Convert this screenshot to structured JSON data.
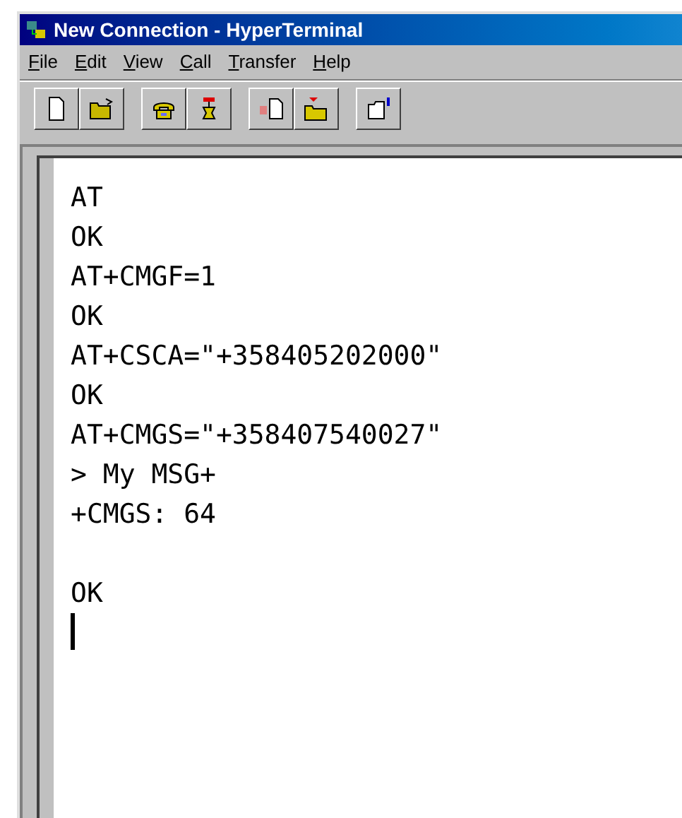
{
  "window": {
    "title": "New Connection - HyperTerminal"
  },
  "menu": [
    "File",
    "Edit",
    "View",
    "Call",
    "Transfer",
    "Help"
  ],
  "toolbar": [
    {
      "kind": "new"
    },
    {
      "kind": "open"
    },
    {
      "kind": "gap"
    },
    {
      "kind": "call"
    },
    {
      "kind": "hangup"
    },
    {
      "kind": "gap"
    },
    {
      "kind": "send"
    },
    {
      "kind": "receive"
    },
    {
      "kind": "gap"
    },
    {
      "kind": "properties"
    }
  ],
  "terminal": {
    "cursor": true,
    "lines": [
      {
        "kind": "text",
        "text": "AT"
      },
      {
        "kind": "text",
        "text": "OK"
      },
      {
        "kind": "text",
        "text": "AT+CMGF=1"
      },
      {
        "kind": "text",
        "text": "OK"
      },
      {
        "kind": "text",
        "text": "AT+CSCA=\"+358405202000\""
      },
      {
        "kind": "text",
        "text": "OK"
      },
      {
        "kind": "text",
        "text": "AT+CMGS=\"+358407540027\""
      },
      {
        "kind": "text",
        "text": "> My MSG+"
      },
      {
        "kind": "text",
        "text": "+CMGS: 64"
      },
      {
        "kind": "blank"
      },
      {
        "kind": "text",
        "text": "OK"
      }
    ]
  }
}
